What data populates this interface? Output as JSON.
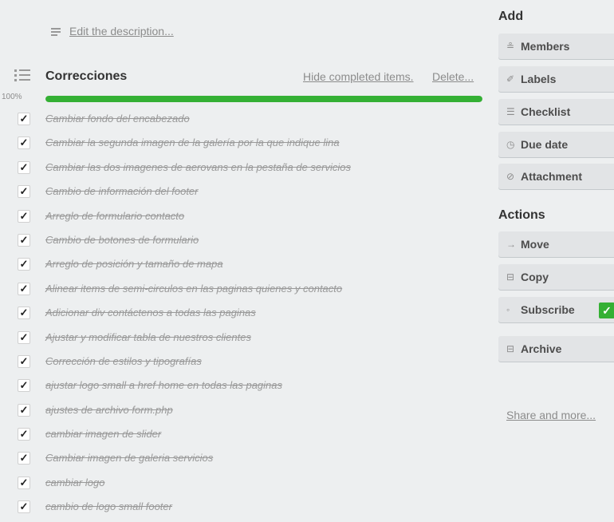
{
  "description": {
    "link_label": "Edit the description...",
    "icon": "description-lines-icon"
  },
  "checklist": {
    "title": "Correcciones",
    "hide_completed_label": "Hide completed items.",
    "delete_label": "Delete...",
    "progress_label": "100%",
    "progress_fraction": 1.0,
    "progress_color": "#34b034",
    "icon": "checklist-icon",
    "items": [
      {
        "text": "Cambiar fondo del encabezado",
        "checked": true,
        "check": "✓"
      },
      {
        "text": "Cambiar la segunda imagen de la galería por la que indique lina",
        "checked": true,
        "check": "✓"
      },
      {
        "text": "Cambiar las dos imagenes de aerovans en la pestaña de servicios",
        "checked": true,
        "check": "✓"
      },
      {
        "text": "Cambio de información del footer",
        "checked": true,
        "check": "✓"
      },
      {
        "text": "Arreglo de formulario contacto",
        "checked": true,
        "check": "✓"
      },
      {
        "text": "Cambio de botones de formulario",
        "checked": true,
        "check": "✓"
      },
      {
        "text": "Arreglo de posición y tamaño de mapa",
        "checked": true,
        "check": "✓"
      },
      {
        "text": "Alinear items de semi-circulos en las paginas quienes y contacto",
        "checked": true,
        "check": "✓"
      },
      {
        "text": "Adicionar div contáctenos a todas las paginas",
        "checked": true,
        "check": "✓"
      },
      {
        "text": "Ajustar y modificar tabla de nuestros clientes",
        "checked": true,
        "check": "✓"
      },
      {
        "text": "Corrección de estilos y tipografías",
        "checked": true,
        "check": "✓"
      },
      {
        "text": "ajustar logo small a href home en todas las paginas",
        "checked": true,
        "check": "✓"
      },
      {
        "text": "ajustes de archivo form.php",
        "checked": true,
        "check": "✓"
      },
      {
        "text": "cambiar imagen de slider",
        "checked": true,
        "check": "✓"
      },
      {
        "text": "Cambiar imagen de galeria servicios",
        "checked": true,
        "check": "✓"
      },
      {
        "text": "cambiar logo",
        "checked": true,
        "check": "✓"
      },
      {
        "text": "cambio de logo small footer",
        "checked": true,
        "check": "✓"
      }
    ]
  },
  "sidebar": {
    "add_heading": "Add",
    "add_buttons": [
      {
        "label": "Members",
        "icon": "person-icon",
        "glyph": "≗"
      },
      {
        "label": "Labels",
        "icon": "tag-icon",
        "glyph": "✐"
      },
      {
        "label": "Checklist",
        "icon": "checklist-icon",
        "glyph": "☰"
      },
      {
        "label": "Due date",
        "icon": "clock-icon",
        "glyph": "◷"
      },
      {
        "label": "Attachment",
        "icon": "paperclip-icon",
        "glyph": "⊘"
      }
    ],
    "actions_heading": "Actions",
    "action_buttons": [
      {
        "label": "Move",
        "icon": "arrow-right-icon",
        "glyph": "→"
      },
      {
        "label": "Copy",
        "icon": "copy-icon",
        "glyph": "⊟"
      },
      {
        "label": "Subscribe",
        "icon": "eye-icon",
        "glyph": "◦",
        "checked": true,
        "check": "✓"
      },
      {
        "label": "Archive",
        "icon": "archive-icon",
        "glyph": "⊟"
      }
    ],
    "share_label": "Share and more..."
  }
}
